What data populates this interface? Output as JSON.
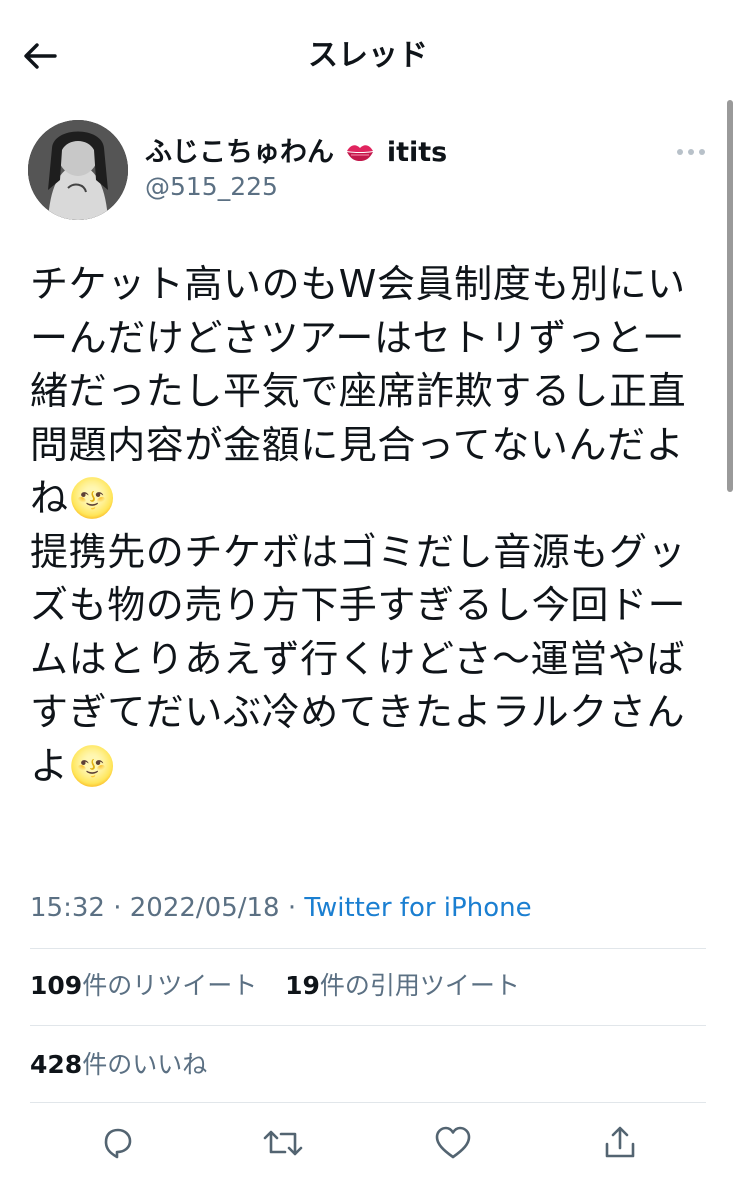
{
  "header": {
    "title": "スレッド"
  },
  "author": {
    "name": "ふじこちゅわん",
    "name_suffix": "itits",
    "handle": "@515_225"
  },
  "tweet": {
    "text": "チケット高いのもW会員制度も別にいーんだけどさツアーはセトリずっと一緒だったし平気で座席詐欺するし正直問題内容が金額に見合ってないんだよね🌝\n提携先のチケボはゴミだし音源もグッズも物の売り方下手すぎるし今回ドームはとりあえず行くけどさ〜運営やばすぎてだいぶ冷めてきたよラルクさんよ🌝"
  },
  "meta": {
    "time": "15:32",
    "date": "2022/05/18",
    "source": "Twitter for iPhone",
    "separator": " · "
  },
  "stats": {
    "retweets_count": "109",
    "retweets_label": "件のリツイート",
    "quotes_count": "19",
    "quotes_label": "件の引用ツイート",
    "likes_count": "428",
    "likes_label": "件のいいね"
  },
  "colors": {
    "accent": "#1b7fd1",
    "muted": "#5b7083",
    "divider": "#e1e6ea"
  }
}
